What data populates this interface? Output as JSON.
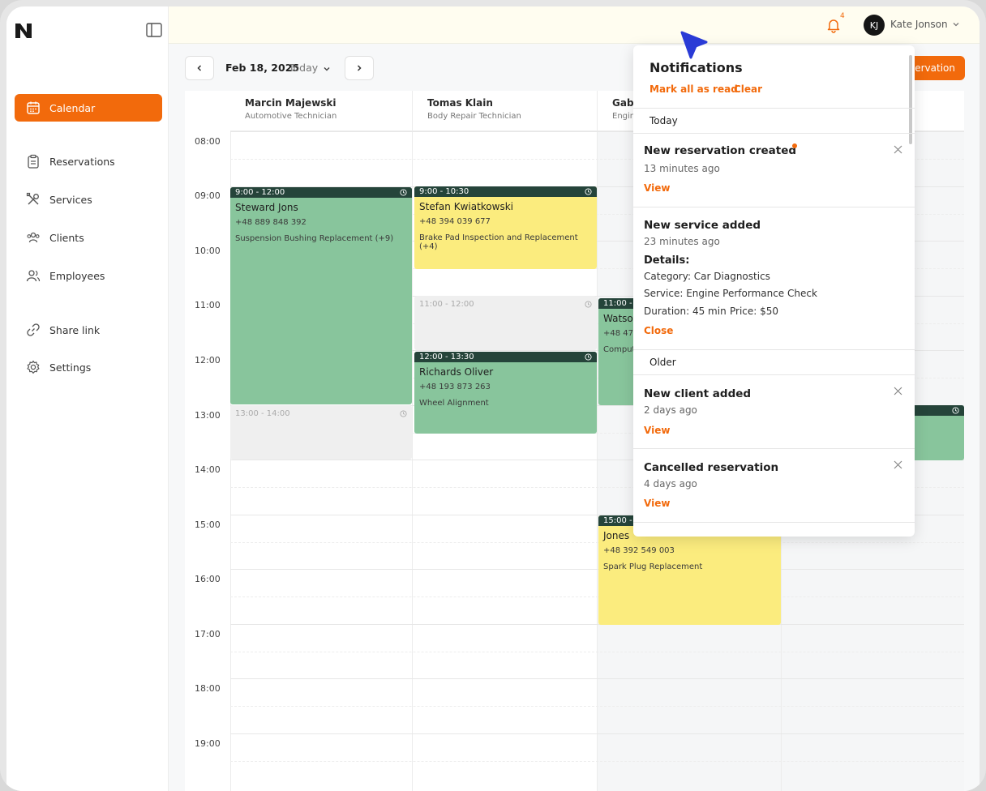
{
  "colors": {
    "accent": "#f26a0c",
    "event_green": "#88c59c",
    "event_yellow": "#fbec7e",
    "event_bar": "#25443a",
    "blocked": "#efefef"
  },
  "topbar": {
    "notification_count": "4",
    "avatar_initials": "KJ",
    "user_name": "Kate Jonson"
  },
  "sidebar": {
    "items": [
      {
        "label": "Calendar",
        "icon": "calendar-icon",
        "active": true
      },
      {
        "label": "Reservations",
        "icon": "clipboard-icon"
      },
      {
        "label": "Services",
        "icon": "tools-icon"
      },
      {
        "label": "Clients",
        "icon": "users-icon"
      },
      {
        "label": "Employees",
        "icon": "user-group-icon"
      },
      {
        "label": "Share link",
        "icon": "link-icon"
      },
      {
        "label": "Settings",
        "icon": "gear-icon"
      }
    ]
  },
  "toolbar": {
    "date": "Feb 18, 2025",
    "today": "Today",
    "new_button": "servation"
  },
  "calendar": {
    "hours": [
      "08:00",
      "09:00",
      "10:00",
      "11:00",
      "12:00",
      "13:00",
      "14:00",
      "15:00",
      "16:00",
      "17:00",
      "18:00",
      "19:00"
    ],
    "columns": [
      {
        "name": "Marcin Majewski",
        "role": "Automotive Technician"
      },
      {
        "name": "Tomas Klain",
        "role": "Body Repair Technician"
      },
      {
        "name": "Gab",
        "role": "Engin"
      },
      {
        "name": "",
        "role": ""
      }
    ],
    "events": [
      {
        "col": 0,
        "time": "9:00 - 12:00",
        "name": "Steward Jons",
        "phone": "+48 889 848 392",
        "service": "Suspension Bushing Replacement (+9)",
        "color": "green"
      },
      {
        "col": 0,
        "time": "13:00 - 14:00",
        "blocked": true
      },
      {
        "col": 1,
        "time": "9:00 - 10:30",
        "name": "Stefan Kwiatkowski",
        "phone": "+48 394 039 677",
        "service": "Brake Pad Inspection and Replacement (+4)",
        "color": "yellow"
      },
      {
        "col": 1,
        "time": "11:00 - 12:00",
        "blocked": true
      },
      {
        "col": 1,
        "time": "12:00 - 13:30",
        "name": "Richards Oliver",
        "phone": "+48 193 873 263",
        "service": "Wheel Alignment",
        "color": "green"
      },
      {
        "col": 2,
        "time": "11:00 - 1",
        "name": "Watso",
        "phone": "+48 475",
        "service": "Comput",
        "color": "green"
      },
      {
        "col": 2,
        "time": "15:00 -",
        "name": "Jones",
        "phone": "+48  392 549 003",
        "service": "Spark Plug Replacement",
        "color": "yellow"
      }
    ]
  },
  "notifications": {
    "title": "Notifications",
    "mark_all": "Mark all as read",
    "clear": "Clear",
    "groups": {
      "today": "Today",
      "older": "Older"
    },
    "items": [
      {
        "title": "New reservation created",
        "time": "13 minutes ago",
        "action": "View",
        "unread": true
      },
      {
        "title": "New service added",
        "time": "23 minutes ago",
        "action": "Close",
        "details_label": "Details:",
        "category": "Category: Car Diagnostics",
        "service": "Service: Engine Performance Check",
        "duration": "Duration: 45 min",
        "price": "Price: $50"
      },
      {
        "title": "New client added",
        "time": "2 days ago",
        "action": "View"
      },
      {
        "title": "Cancelled reservation",
        "time": "4 days ago",
        "action": "View"
      }
    ]
  }
}
